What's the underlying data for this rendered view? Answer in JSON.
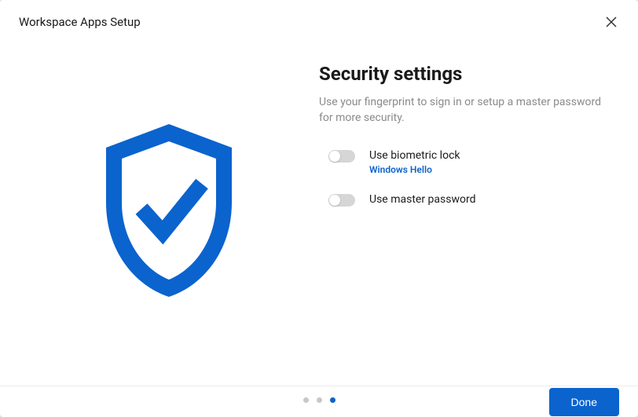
{
  "header": {
    "title": "Workspace Apps Setup"
  },
  "main": {
    "heading": "Security settings",
    "description": "Use your fingerprint to sign in or setup a master password for more security.",
    "options": {
      "biometric": {
        "label": "Use biometric lock",
        "sublabel": "Windows Hello"
      },
      "master_password": {
        "label": "Use master password"
      }
    }
  },
  "footer": {
    "done_label": "Done"
  },
  "colors": {
    "primary": "#0b63ce"
  }
}
